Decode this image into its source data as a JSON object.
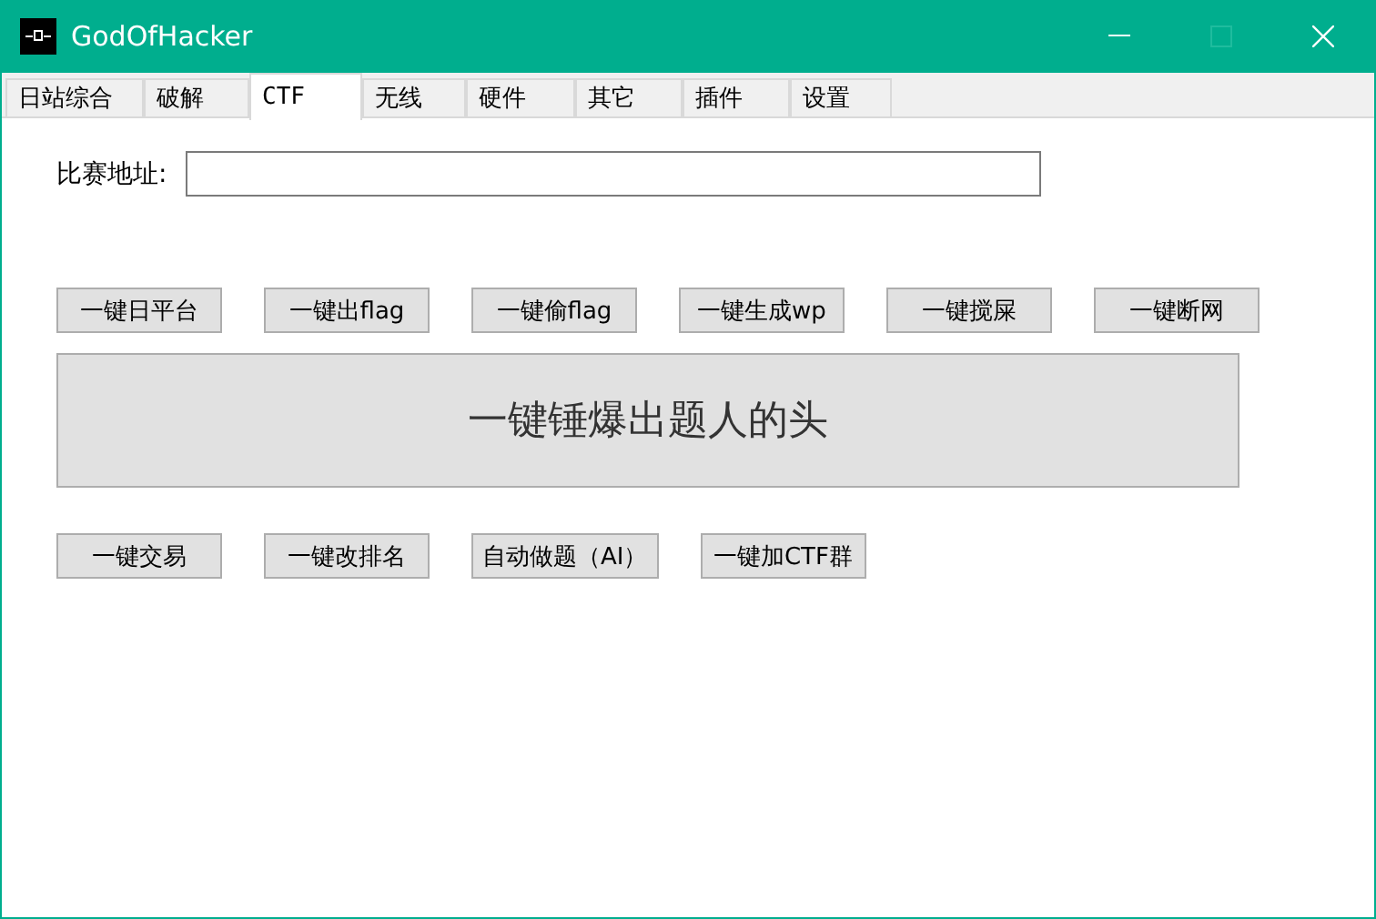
{
  "window": {
    "title": "GodOfHacker",
    "controls": [
      {
        "kind": "minimize",
        "disabled": false
      },
      {
        "kind": "maximize",
        "disabled": true
      },
      {
        "kind": "close",
        "disabled": false
      }
    ]
  },
  "tabs": [
    {
      "label": "日站综合",
      "selected": false
    },
    {
      "label": "破解",
      "selected": false
    },
    {
      "label": "CTF",
      "selected": true
    },
    {
      "label": "无线",
      "selected": false
    },
    {
      "label": "硬件",
      "selected": false
    },
    {
      "label": "其它",
      "selected": false
    },
    {
      "label": "插件",
      "selected": false
    },
    {
      "label": "设置",
      "selected": false
    }
  ],
  "address_field": {
    "label": "比赛地址:"
  },
  "button_rows": [
    [
      "一键日平台",
      "一键出flag",
      "一键偷flag",
      "一键生成wp",
      "一键搅屎",
      "一键断网"
    ],
    [
      "一键锤爆出题人的头"
    ],
    [
      "一键交易",
      "一键改排名",
      "自动做题（AI）",
      "一键加CTF群"
    ]
  ]
}
